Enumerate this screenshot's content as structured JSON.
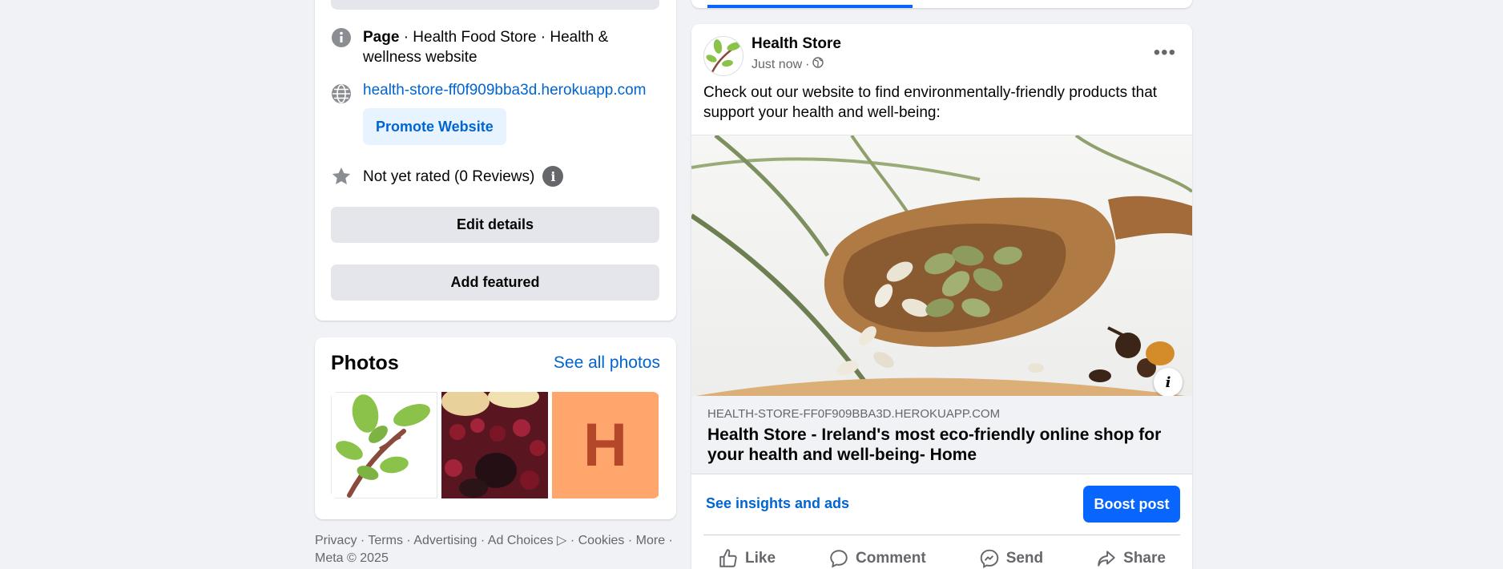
{
  "intro": {
    "category_prefix": "Page",
    "category_rest": " · Health Food Store · Health & wellness website",
    "website": "health-store-ff0f909bba3d.herokuapp.com",
    "promote_label": "Promote Website",
    "rating_text": "Not yet rated (0 Reviews)",
    "edit_details_label": "Edit details",
    "add_featured_label": "Add featured"
  },
  "photos": {
    "title": "Photos",
    "see_all_label": "See all photos",
    "thumb_letter": "H"
  },
  "footer": {
    "links": [
      "Privacy",
      "Terms",
      "Advertising",
      "Ad Choices",
      "Cookies"
    ],
    "more_label": "More",
    "copyright": "Meta © 2025"
  },
  "post": {
    "author": "Health Store",
    "time": "Just now",
    "text": "Check out our website to find environmentally-friendly products that support your health and well-being:",
    "link_domain": "HEALTH-STORE-FF0F909BBA3D.HEROKUAPP.COM",
    "link_title": "Health Store - Ireland's most eco-friendly online shop for your health and well-being- Home",
    "insights_label": "See insights and ads",
    "boost_label": "Boost post",
    "actions": [
      "Like",
      "Comment",
      "Send",
      "Share"
    ]
  },
  "colors": {
    "accent": "#0866ff",
    "link": "#0064d1",
    "background": "#f0f2f5"
  }
}
